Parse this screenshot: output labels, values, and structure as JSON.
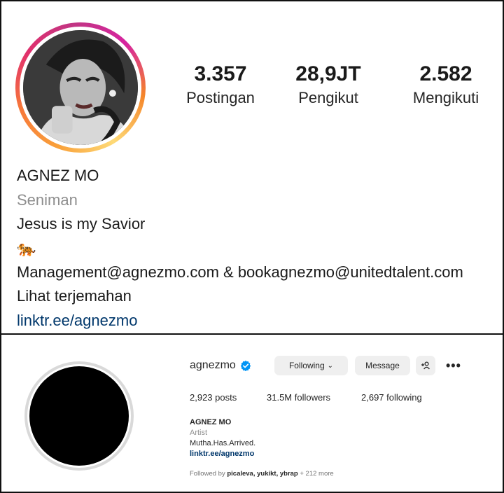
{
  "top_profile": {
    "stats": [
      {
        "value": "3.357",
        "label": "Postingan"
      },
      {
        "value": "28,9JT",
        "label": "Pengikut"
      },
      {
        "value": "2.582",
        "label": "Mengikuti"
      }
    ],
    "name": "AGNEZ MO",
    "category": "Seniman",
    "bio_line": "Jesus is my Savior",
    "emoji": "🐅",
    "contact": "Management@agnezmo.com & bookagnezmo@unitedtalent.com",
    "translate_link": "Lihat terjemahan",
    "link": "linktr.ee/agnezmo",
    "story_ring_colors": [
      "#feda77",
      "#f58529",
      "#dd2a7b",
      "#8134af"
    ]
  },
  "bottom_profile": {
    "username": "agnezmo",
    "verified_badge_color": "#0095f6",
    "buttons": {
      "following": "Following",
      "message": "Message",
      "add_user_icon": "add-person-icon",
      "more": "•••"
    },
    "stats": {
      "posts": "2,923 posts",
      "followers": "31.5M followers",
      "following": "2,697 following"
    },
    "name": "AGNEZ MO",
    "category": "Artist",
    "bio_line": "Mutha.Has.Arrived.",
    "link": "linktr.ee/agnezmo",
    "followed_by_prefix": "Followed by",
    "followed_by_names": "picaleva, yukikt, ybrap",
    "followed_by_more": "+ 212 more"
  }
}
